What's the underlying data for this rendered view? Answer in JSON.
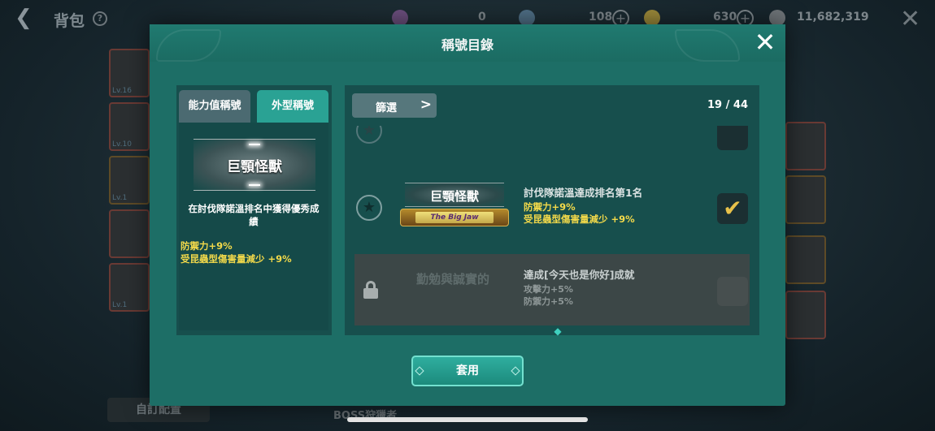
{
  "background": {
    "title": "背包",
    "help_icon": "?",
    "resources": [
      {
        "icon": "purple-orb-icon",
        "value": "0",
        "color": "#6c4f7e"
      },
      {
        "icon": "blue-gem-icon",
        "value": "108",
        "color": "#4f6f86"
      },
      {
        "icon": "gold-coin-icon",
        "value": "630",
        "color": "#9c8a3a"
      },
      {
        "icon": "silver-coin-icon",
        "value": "11,682,319",
        "color": "#6e7478"
      }
    ],
    "bottom_left_label": "自訂配置",
    "bottom_text": "BOSS狩獵者"
  },
  "modal": {
    "title": "稱號目錄",
    "close_icon": "✕",
    "tabs": [
      {
        "label": "能力值稱號",
        "active": false
      },
      {
        "label": "外型稱號",
        "active": true
      }
    ],
    "selected": {
      "name": "巨顎怪獸",
      "description": "在討伐隊諾溫排名中獲得優秀成績",
      "stats": [
        "防禦力+9%",
        "受昆蟲型傷害量減少 +9%"
      ]
    },
    "filter_label": "篩選",
    "count": "19 / 44",
    "list": [
      {
        "name": "巨顎怪獸",
        "banner": "The Big Jaw",
        "condition": "討伐隊諾溫達成排名第1名",
        "stats": [
          "防禦力+9%",
          "受昆蟲型傷害量減少 +9%"
        ],
        "equipped": true,
        "locked": false
      },
      {
        "name": "勤勉與誠實的",
        "condition": "達成[今天也是你好]成就",
        "stats": [
          "攻擊力+5%",
          "防禦力+5%"
        ],
        "equipped": false,
        "locked": true
      }
    ],
    "apply_label": "套用"
  },
  "colors": {
    "modal_bg": "#1d6e66",
    "accent": "#2aa294",
    "stat_yellow": "#f2d94a",
    "check_gold": "#e8c14a"
  }
}
